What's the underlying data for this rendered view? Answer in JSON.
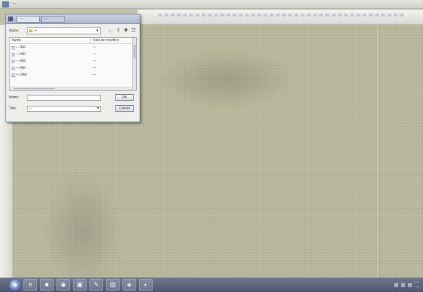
{
  "app": {
    "title": "—",
    "menu_text": ""
  },
  "dialog": {
    "tabs": [
      {
        "label": "—"
      },
      {
        "label": "—"
      }
    ],
    "look_in": {
      "label": "Nome:",
      "value": "—"
    },
    "toolbar_icons": [
      "back-icon",
      "up-folder-icon",
      "new-folder-icon",
      "view-menu-icon"
    ],
    "columns": {
      "name": "Name",
      "date": "Data de modifica"
    },
    "files": [
      {
        "name": "—.AEI",
        "date": "—"
      },
      {
        "name": "—.AEI",
        "date": "—"
      },
      {
        "name": "—.AEI",
        "date": "—"
      },
      {
        "name": "—.AEI",
        "date": "—"
      },
      {
        "name": "—.DEF",
        "date": "—"
      }
    ],
    "filename": {
      "label": "Nome:",
      "value": "",
      "button": "OK"
    },
    "filetype": {
      "label": "Tipo:",
      "value": "—",
      "button": "Cancel"
    }
  },
  "taskbar": {
    "start_glyph": "❖",
    "items": [
      {
        "glyph": "e"
      },
      {
        "glyph": "■"
      },
      {
        "glyph": "◉"
      },
      {
        "glyph": "▣"
      },
      {
        "glyph": "✎"
      },
      {
        "glyph": "▤"
      },
      {
        "glyph": "◈"
      },
      {
        "glyph": "◐"
      }
    ],
    "clock_time": "—",
    "clock_date": "—"
  }
}
